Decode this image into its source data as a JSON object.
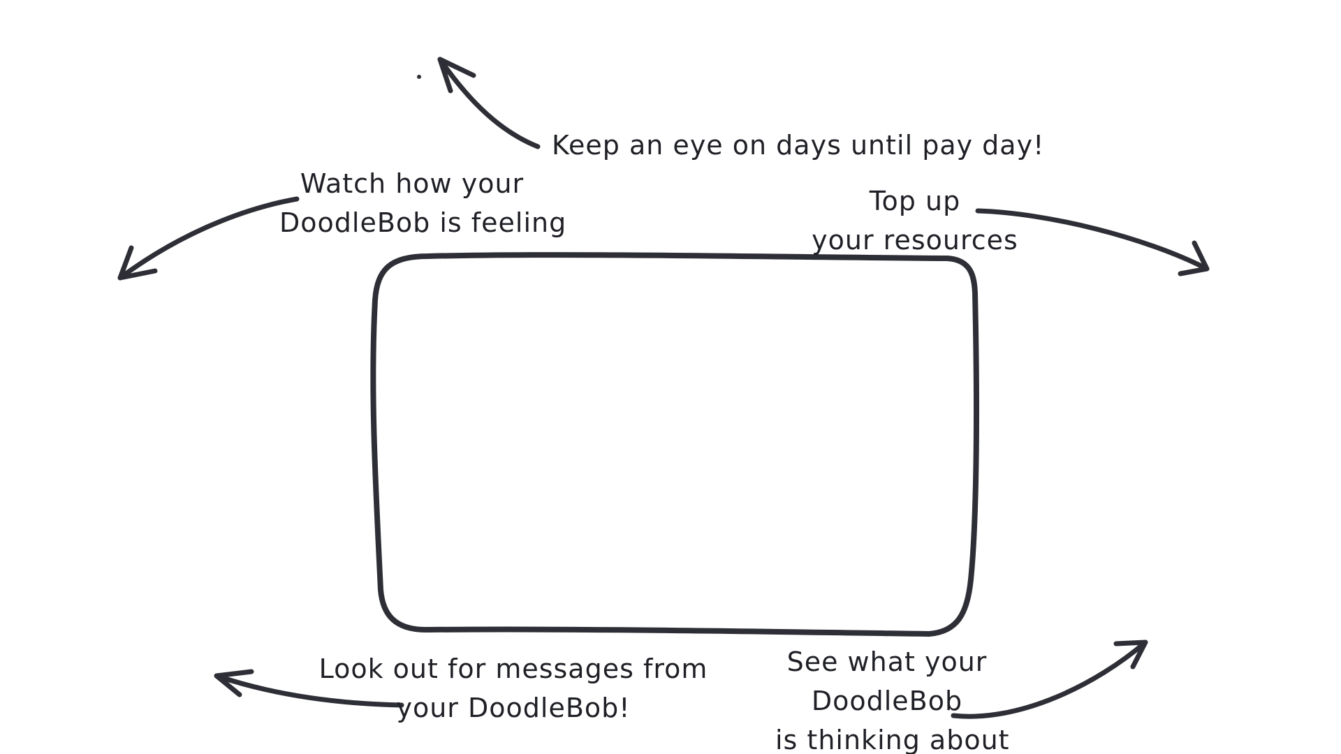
{
  "annotations": {
    "pay_day": [
      "Keep an eye on days until pay day!"
    ],
    "feeling": [
      "Watch how your",
      "DoodleBob is feeling"
    ],
    "resources": [
      "Top up",
      "your resources"
    ],
    "messages": [
      "Look out for messages from",
      "your DoodleBob!"
    ],
    "thinking": [
      "See what your",
      "DoodleBob",
      "is thinking about"
    ]
  },
  "colors": {
    "ink": "#2e2f36",
    "background": "#ffffff"
  }
}
